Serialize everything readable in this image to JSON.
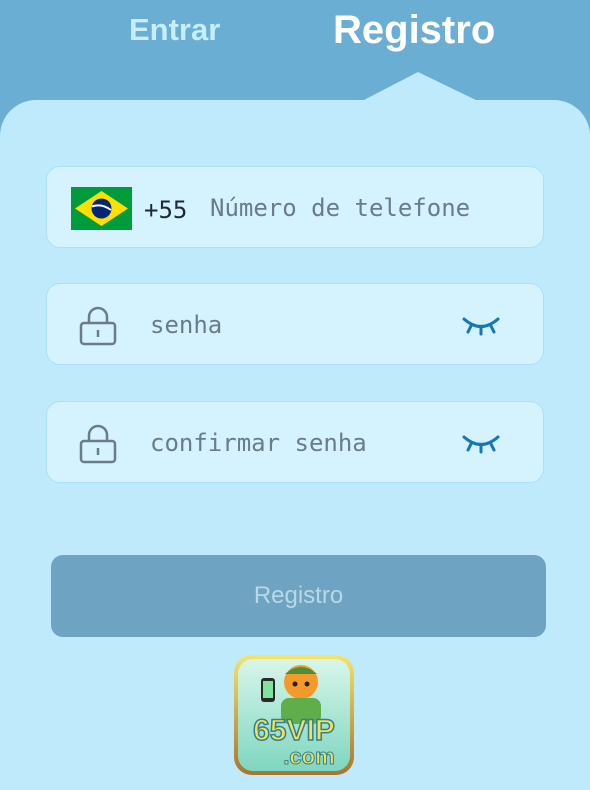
{
  "tabs": {
    "login_label": "Entrar",
    "register_label": "Registro"
  },
  "phone": {
    "country_code": "+55",
    "placeholder": "Número de telefone",
    "value": ""
  },
  "password": {
    "placeholder": "senha",
    "value": ""
  },
  "confirm_password": {
    "placeholder": "confirmar senha",
    "value": ""
  },
  "submit": {
    "label": "Registro"
  },
  "logo": {
    "text_main": "65VIP",
    "text_sub": ".com"
  },
  "colors": {
    "header_bg": "#6aaed4",
    "panel_bg": "#bfeafc",
    "field_bg": "#d4f3fe",
    "eye_icon": "#1677b3",
    "button_bg": "#6ea3c2"
  },
  "icons": [
    "brazil-flag-icon",
    "lock-icon",
    "eye-closed-icon"
  ]
}
